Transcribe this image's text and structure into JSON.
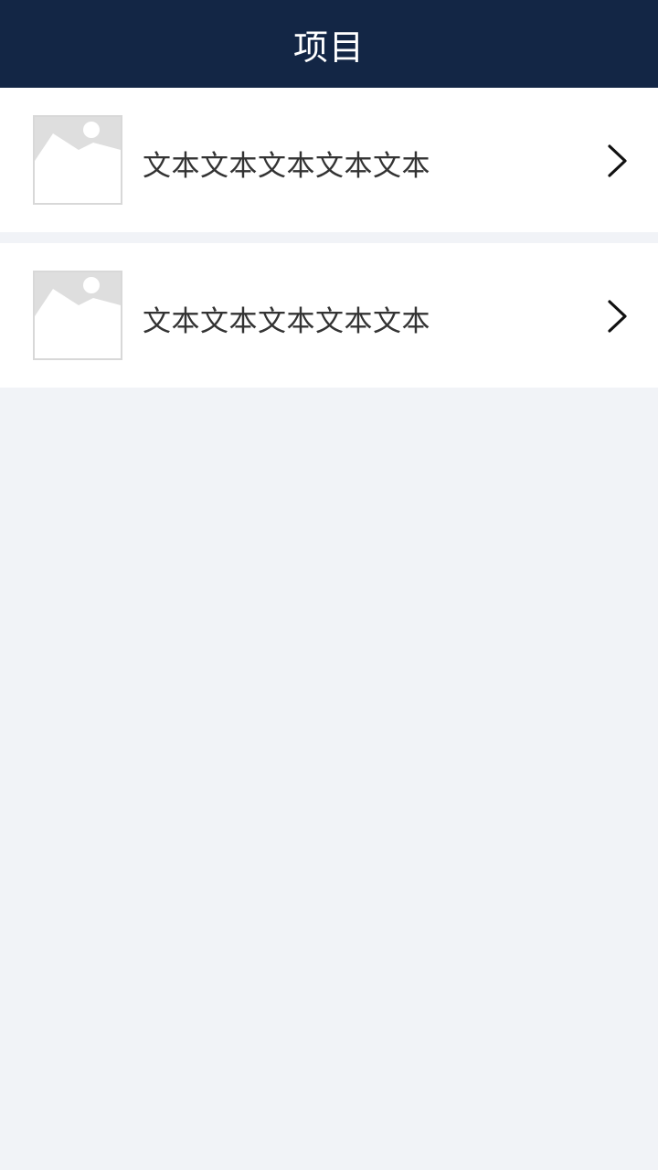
{
  "header": {
    "title": "项目"
  },
  "list": {
    "items": [
      {
        "label": "文本文本文本文本文本",
        "thumbnail_icon": "image-placeholder-icon",
        "trailing_icon": "chevron-right-icon"
      },
      {
        "label": "文本文本文本文本文本",
        "thumbnail_icon": "image-placeholder-icon",
        "trailing_icon": "chevron-right-icon"
      }
    ]
  },
  "colors": {
    "header_bg": "#132645",
    "page_bg": "#f1f3f7",
    "item_bg": "#ffffff",
    "text": "#333333",
    "placeholder": "#dddddd"
  }
}
